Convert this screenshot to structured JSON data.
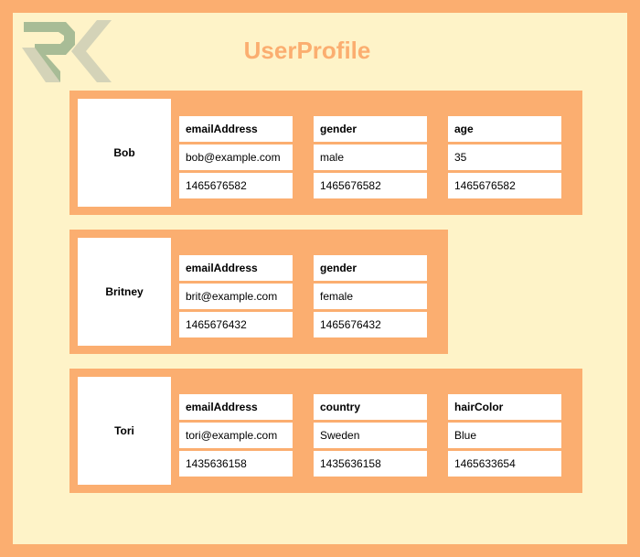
{
  "header": {
    "title": "UserProfile",
    "logo_icon": "rk-monogram-logo",
    "logo_colors": {
      "primary": "#a8bc96",
      "secondary": "#d4d3b8"
    }
  },
  "theme": {
    "outer_border": "#fbae70",
    "page_background": "#fef3c8",
    "band_background": "#fbae70",
    "card_background": "#ffffff",
    "title_color": "#fbae70",
    "text_color": "#000000"
  },
  "profiles": [
    {
      "name": "Bob",
      "attributes": [
        {
          "key": "emailAddress",
          "value": "bob@example.com",
          "timestamp": "1465676582"
        },
        {
          "key": "gender",
          "value": "male",
          "timestamp": "1465676582"
        },
        {
          "key": "age",
          "value": "35",
          "timestamp": "1465676582"
        }
      ]
    },
    {
      "name": "Britney",
      "attributes": [
        {
          "key": "emailAddress",
          "value": "brit@example.com",
          "timestamp": "1465676432"
        },
        {
          "key": "gender",
          "value": "female",
          "timestamp": "1465676432"
        }
      ]
    },
    {
      "name": "Tori",
      "attributes": [
        {
          "key": "emailAddress",
          "value": "tori@example.com",
          "timestamp": "1435636158"
        },
        {
          "key": "country",
          "value": "Sweden",
          "timestamp": "1435636158"
        },
        {
          "key": "hairColor",
          "value": "Blue",
          "timestamp": "1465633654"
        }
      ]
    }
  ]
}
